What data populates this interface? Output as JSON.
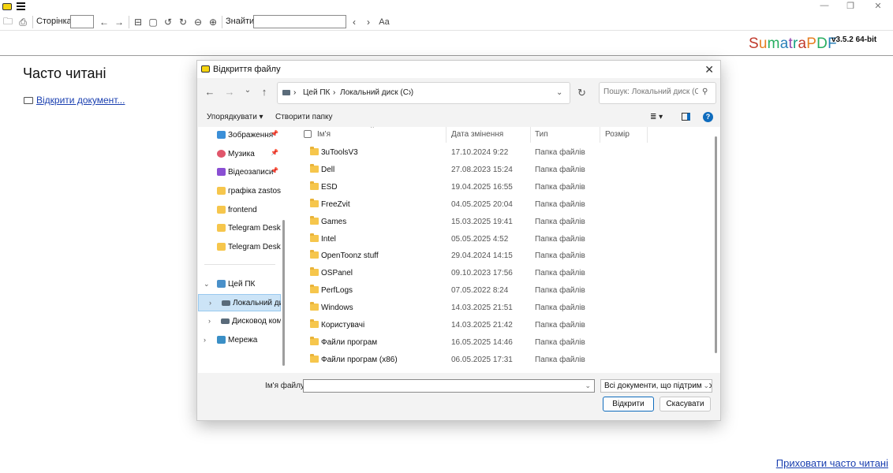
{
  "toolbar": {
    "page_label": "Сторінка:",
    "find_label": "Знайти:",
    "page_value": "",
    "find_value": ""
  },
  "brand": {
    "letters": [
      "S",
      "u",
      "m",
      "a",
      "t",
      "r",
      "a",
      "P",
      "D",
      "F"
    ],
    "version": "v3.5.2 64-bit"
  },
  "home": {
    "title": "Часто читані",
    "open_document": "Відкрити документ...",
    "hide_frequent": "Приховати часто читані"
  },
  "dialog": {
    "title": "Відкриття файлу",
    "address": [
      "Цей ПК",
      "Локальний диск (C:)"
    ],
    "search_placeholder": "Пошук: Локальний диск (C:)",
    "organize": "Упорядкувати",
    "new_folder": "Створити папку",
    "columns": {
      "name": "Ім'я",
      "date": "Дата змінення",
      "type": "Тип",
      "size": "Розмір"
    },
    "nav_items": [
      {
        "label": "Зображення",
        "icon": "pictures-icon",
        "pinned": true
      },
      {
        "label": "Музика",
        "icon": "music-icon",
        "pinned": true
      },
      {
        "label": "Відеозаписи",
        "icon": "videos-icon",
        "pinned": true
      },
      {
        "label": "графіка zastosu",
        "icon": "folder-icon",
        "pinned": false
      },
      {
        "label": "frontend",
        "icon": "folder-icon",
        "pinned": false
      },
      {
        "label": "Telegram Deskto",
        "icon": "folder-icon",
        "pinned": false
      },
      {
        "label": "Telegram Deskto",
        "icon": "folder-icon",
        "pinned": false
      },
      {
        "label": "Цей ПК",
        "icon": "this-pc-icon",
        "pinned": false
      },
      {
        "label": "Локальний ди",
        "icon": "drive-icon",
        "pinned": false
      },
      {
        "label": "Дисковод ком",
        "icon": "drive-icon",
        "pinned": false
      },
      {
        "label": "Мережа",
        "icon": "network-icon",
        "pinned": false
      }
    ],
    "files": [
      {
        "name": "3uToolsV3",
        "date": "17.10.2024 9:22",
        "type": "Папка файлів"
      },
      {
        "name": "Dell",
        "date": "27.08.2023 15:24",
        "type": "Папка файлів"
      },
      {
        "name": "ESD",
        "date": "19.04.2025 16:55",
        "type": "Папка файлів"
      },
      {
        "name": "FreeZvit",
        "date": "04.05.2025 20:04",
        "type": "Папка файлів"
      },
      {
        "name": "Games",
        "date": "15.03.2025 19:41",
        "type": "Папка файлів"
      },
      {
        "name": "Intel",
        "date": "05.05.2025 4:52",
        "type": "Папка файлів"
      },
      {
        "name": "OpenToonz stuff",
        "date": "29.04.2024 14:15",
        "type": "Папка файлів"
      },
      {
        "name": "OSPanel",
        "date": "09.10.2023 17:56",
        "type": "Папка файлів"
      },
      {
        "name": "PerfLogs",
        "date": "07.05.2022 8:24",
        "type": "Папка файлів"
      },
      {
        "name": "Windows",
        "date": "14.03.2025 21:51",
        "type": "Папка файлів"
      },
      {
        "name": "Користувачі",
        "date": "14.03.2025 21:42",
        "type": "Папка файлів"
      },
      {
        "name": "Файли програм",
        "date": "16.05.2025 14:46",
        "type": "Папка файлів"
      },
      {
        "name": "Файли програм (x86)",
        "date": "06.05.2025 17:31",
        "type": "Папка файлів"
      }
    ],
    "filename_label": "Ім'я файлу:",
    "filename_value": "",
    "filetype": "Всі документи, що підтримуються",
    "open_button": "Відкрити",
    "cancel_button": "Скасувати"
  },
  "colors": {
    "accent": "#0f6cbd",
    "link": "#1a3fb0",
    "folder": "#f6c64c",
    "selected_nav": "#cce4f7"
  }
}
